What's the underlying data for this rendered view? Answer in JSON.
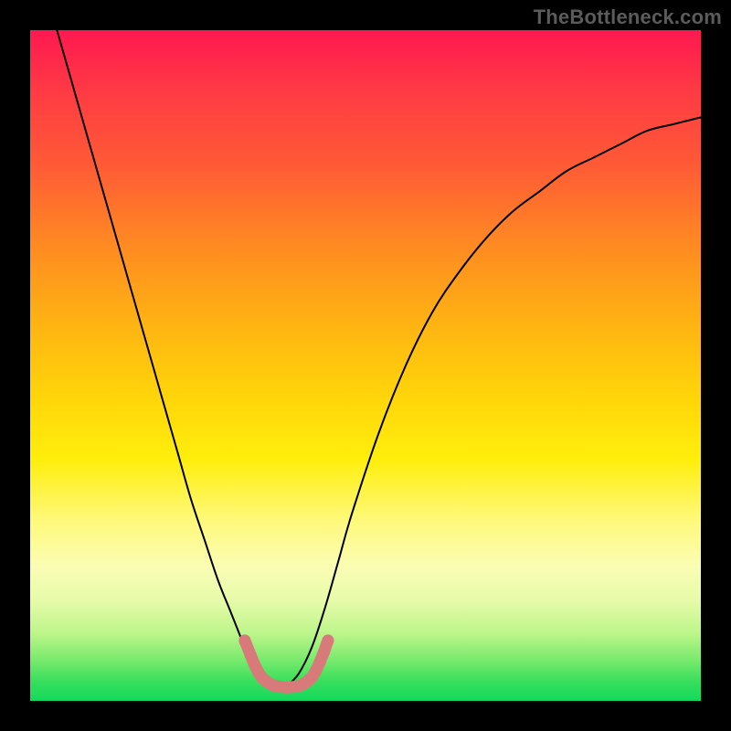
{
  "watermark": "TheBottleneck.com",
  "colors": {
    "background": "#000000",
    "curve_stroke": "#000000",
    "marker_fill": "#d87a7a",
    "marker_stroke": "#d87a7a",
    "gradient_top": "#ff1850",
    "gradient_bottom": "#12d95c"
  },
  "chart_data": {
    "type": "line",
    "title": "",
    "xlabel": "",
    "ylabel": "",
    "xlim": [
      0,
      100
    ],
    "ylim": [
      0,
      100
    ],
    "series": [
      {
        "name": "left-curve",
        "x": [
          4,
          6,
          8,
          10,
          12,
          14,
          16,
          18,
          20,
          22,
          24,
          26,
          28,
          30,
          32,
          33,
          34,
          35,
          36,
          37,
          38
        ],
        "y": [
          100,
          93,
          86,
          79,
          72,
          65,
          58,
          51,
          44,
          37,
          30,
          24,
          18,
          13,
          8,
          6,
          5,
          4,
          3,
          2.5,
          2
        ]
      },
      {
        "name": "right-curve",
        "x": [
          38,
          40,
          42,
          44,
          46,
          48,
          52,
          56,
          60,
          64,
          68,
          72,
          76,
          80,
          84,
          88,
          92,
          96,
          100
        ],
        "y": [
          2,
          4,
          8,
          14,
          21,
          28,
          40,
          50,
          58,
          64,
          69,
          73,
          76,
          79,
          81,
          83,
          85,
          86,
          87
        ]
      }
    ],
    "markers": [
      {
        "x": 32.0,
        "y": 9.0
      },
      {
        "x": 32.8,
        "y": 7.0
      },
      {
        "x": 33.4,
        "y": 5.5
      },
      {
        "x": 34.0,
        "y": 4.3
      },
      {
        "x": 34.6,
        "y": 3.4
      },
      {
        "x": 35.3,
        "y": 2.8
      },
      {
        "x": 36.2,
        "y": 2.3
      },
      {
        "x": 37.2,
        "y": 2.1
      },
      {
        "x": 38.3,
        "y": 2.0
      },
      {
        "x": 39.4,
        "y": 2.1
      },
      {
        "x": 40.4,
        "y": 2.3
      },
      {
        "x": 41.2,
        "y": 2.8
      },
      {
        "x": 42.0,
        "y": 3.5
      },
      {
        "x": 42.6,
        "y": 4.5
      },
      {
        "x": 43.2,
        "y": 5.8
      },
      {
        "x": 43.8,
        "y": 7.3
      },
      {
        "x": 44.4,
        "y": 9.0
      }
    ]
  }
}
